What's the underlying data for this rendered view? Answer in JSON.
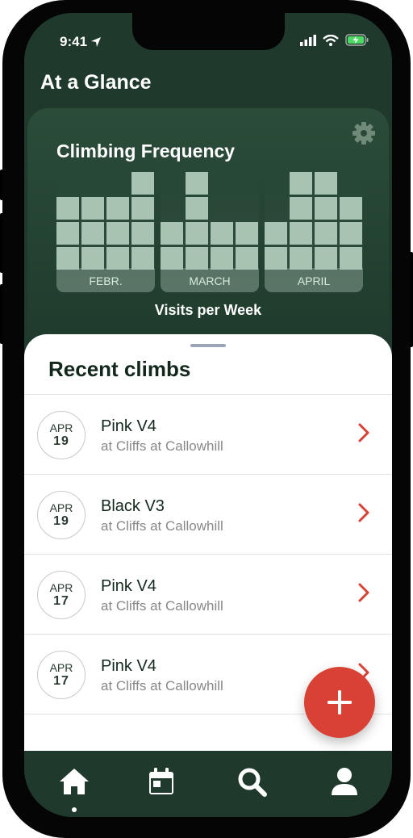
{
  "status_bar": {
    "time": "9:41"
  },
  "header": {
    "title": "At a Glance"
  },
  "chart_card": {
    "title": "Climbing Frequency",
    "xlabel": "Visits per Week"
  },
  "chart_data": {
    "type": "bar",
    "title": "Climbing Frequency",
    "xlabel": "Visits per Week",
    "ylabel": "",
    "months": [
      {
        "label": "FEBR.",
        "weekly_visits": [
          3,
          3,
          3,
          4
        ]
      },
      {
        "label": "MARCH",
        "weekly_visits": [
          2,
          4,
          2,
          2
        ]
      },
      {
        "label": "APRIL",
        "weekly_visits": [
          2,
          4,
          4,
          3
        ]
      }
    ],
    "ylim": [
      0,
      4
    ]
  },
  "recent": {
    "title": "Recent climbs",
    "items": [
      {
        "month": "APR",
        "day": "19",
        "name": "Pink V4",
        "location": "at Cliffs at Callowhill"
      },
      {
        "month": "APR",
        "day": "19",
        "name": "Black V3",
        "location": "at Cliffs at Callowhill"
      },
      {
        "month": "APR",
        "day": "17",
        "name": "Pink V4",
        "location": "at Cliffs at Callowhill"
      },
      {
        "month": "APR",
        "day": "17",
        "name": "Pink V4",
        "location": "at Cliffs at Callowhill"
      }
    ]
  },
  "fab": {
    "icon": "plus-icon"
  },
  "tab_bar": {
    "tabs": [
      {
        "icon": "home-icon",
        "active": true
      },
      {
        "icon": "calendar-icon",
        "active": false
      },
      {
        "icon": "search-icon",
        "active": false
      },
      {
        "icon": "profile-icon",
        "active": false
      }
    ]
  },
  "colors": {
    "background": "#1f3a2c",
    "bar": "#a9c3b2",
    "accent": "#d84133",
    "text_dark": "#13281c"
  }
}
